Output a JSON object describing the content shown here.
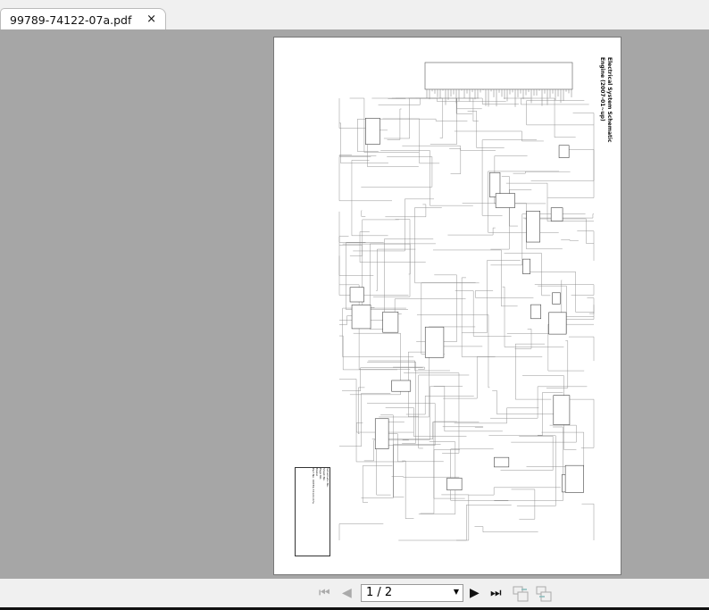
{
  "tab": {
    "title": "99789-74122-07a.pdf",
    "close": "×"
  },
  "document": {
    "title_line1": "Electrical System Schematic",
    "title_line2": "Engine (2007-01~up)",
    "title_block": [
      "Schematic No.",
      "Sheet No.",
      "Page No.",
      "Model",
      "Part No. 99789-74122-07a"
    ]
  },
  "toolbar": {
    "first": "⏮",
    "prev": "◀",
    "page_value": "1 / 2",
    "next": "▶",
    "last": "⏭",
    "colors": {
      "disabled": "#aaaaaa",
      "enabled": "#111111"
    }
  }
}
